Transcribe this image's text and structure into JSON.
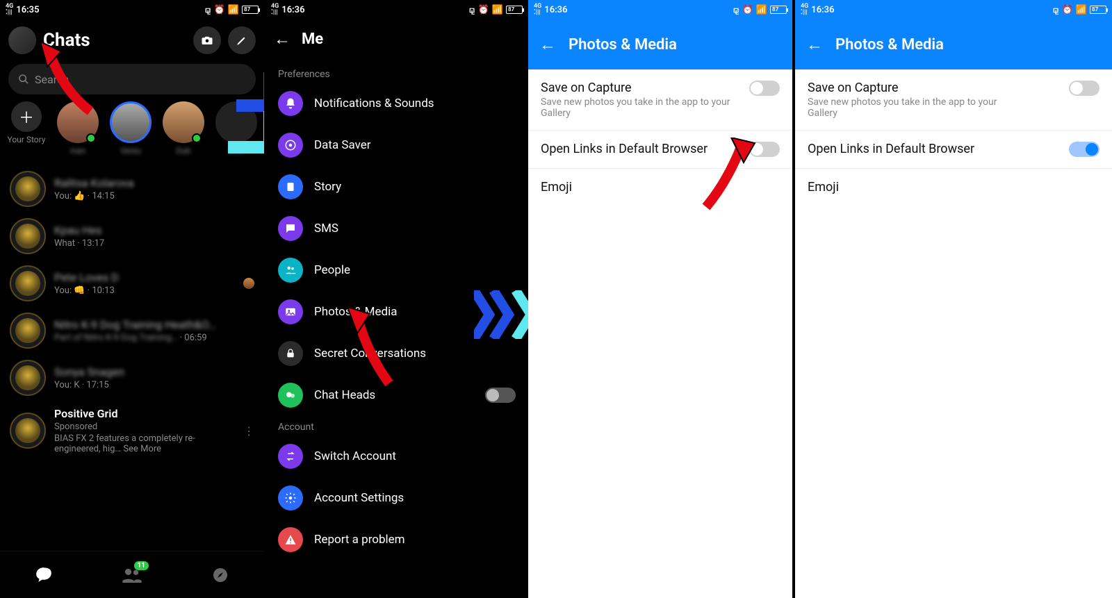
{
  "status": {
    "time1": "16:35",
    "time2": "16:36",
    "battery": "87"
  },
  "chats": {
    "title": "Chats",
    "search_placeholder": "Search",
    "your_story_label": "Your Story",
    "items": [
      {
        "preview": "You: 👍 · 14:15"
      },
      {
        "preview": "What · 13:17"
      },
      {
        "preview": "You: 👊 · 10:13"
      },
      {
        "preview_time": "· 06:59"
      },
      {
        "preview": "You: K · 17:15"
      }
    ],
    "ad": {
      "name": "Positive Grid",
      "sponsored": "Sponsored",
      "body": "BIAS FX 2 features a completely re-engineered, hig…",
      "see_more": "See More"
    },
    "badge": "11"
  },
  "me": {
    "title": "Me",
    "section_preferences": "Preferences",
    "section_account": "Account",
    "items": {
      "notifications": "Notifications & Sounds",
      "data_saver": "Data Saver",
      "story": "Story",
      "sms": "SMS",
      "people": "People",
      "photos": "Photos & Media",
      "secret": "Secret Conversations",
      "chat_heads": "Chat Heads",
      "switch": "Switch Account",
      "settings": "Account Settings",
      "report": "Report a problem"
    }
  },
  "pm": {
    "title": "Photos & Media",
    "save_label": "Save on Capture",
    "save_sub": "Save new photos you take in the app to your Gallery",
    "links_label": "Open Links in Default Browser",
    "emoji_label": "Emoji"
  }
}
